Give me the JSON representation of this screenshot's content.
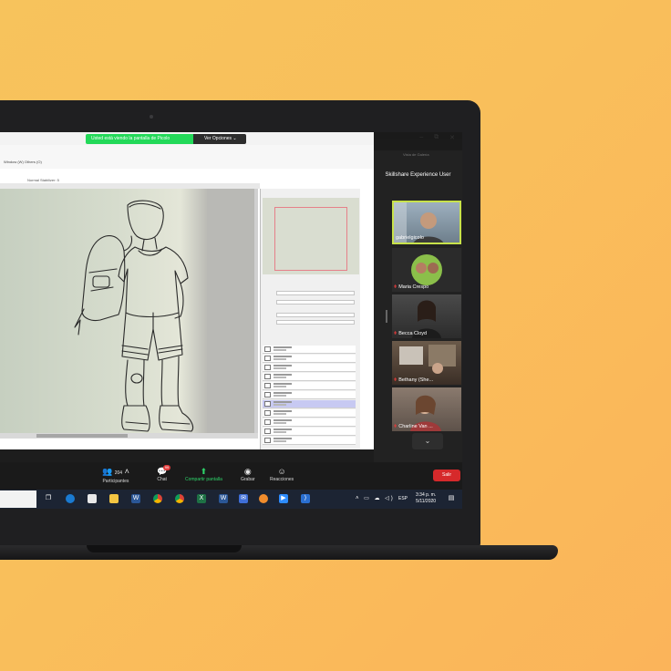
{
  "zoom": {
    "share_banner": "Usted está viendo la pantalla de Picolo",
    "view_options": "Ver Opciones",
    "window_controls": [
      "–",
      "⧉",
      "✕"
    ]
  },
  "app": {
    "menu_title": "Window (W)   Others (O)",
    "mini_menu": "Normal   Stabilizer: 5"
  },
  "controls": {
    "participants_count": "204",
    "participants_label": "Participantes",
    "chat_label": "Chat",
    "chat_badge": "99",
    "share_label": "Compartir pantalla",
    "record_label": "Grabar",
    "reactions_label": "Reacciones",
    "leave_label": "Salir"
  },
  "side_panel": {
    "view_label": "Vista de Galería",
    "title": "Skillshare Experience User",
    "participants": [
      {
        "name": "gabrielgicolo",
        "muted": false,
        "active": true
      },
      {
        "name": "Maria Crespo",
        "muted": true,
        "active": false
      },
      {
        "name": "Becca Cloyd",
        "muted": true,
        "active": false
      },
      {
        "name": "Bethany (She...",
        "muted": true,
        "active": false
      },
      {
        "name": "Charline Van ...",
        "muted": true,
        "active": false
      }
    ],
    "more_icon": "chevron-down-icon"
  },
  "taskbar": {
    "language": "ESP",
    "time": "3:34 p. m.",
    "date": "5/11/2020",
    "icons": [
      "task-view-icon",
      "edge-icon",
      "store-icon",
      "folder-icon",
      "word-icon",
      "chrome-icon",
      "chrome-icon",
      "excel-icon",
      "word-icon",
      "mail-icon",
      "ie-icon",
      "zoom-icon",
      "vscode-icon"
    ]
  },
  "colors": {
    "share_green": "#23d959",
    "leave_red": "#d6292b",
    "active_border": "#c8e24a",
    "background": "#f9bf5b"
  }
}
